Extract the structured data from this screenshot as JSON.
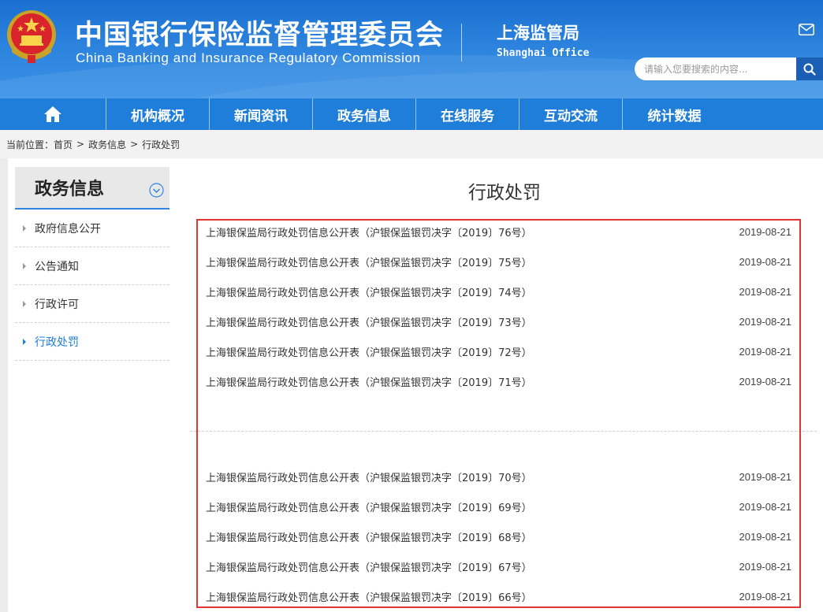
{
  "header": {
    "title_cn": "中国银行保险监督管理委员会",
    "title_en": "China Banking and Insurance Regulatory Commission",
    "office_cn": "上海监管局",
    "office_en": "Shanghai Office",
    "search_placeholder": "请输入您要搜索的内容..."
  },
  "nav": {
    "items": [
      "机构概况",
      "新闻资讯",
      "政务信息",
      "在线服务",
      "互动交流",
      "统计数据"
    ]
  },
  "breadcrumb": {
    "label": "当前位置：",
    "items": [
      "首页",
      "政务信息",
      "行政处罚"
    ],
    "sep": ">"
  },
  "sidebar": {
    "title": "政务信息",
    "items": [
      {
        "label": "政府信息公开",
        "active": false
      },
      {
        "label": "公告通知",
        "active": false
      },
      {
        "label": "行政许可",
        "active": false
      },
      {
        "label": "行政处罚",
        "active": true
      }
    ]
  },
  "main": {
    "title": "行政处罚",
    "list_a": [
      {
        "title": "上海银保监局行政处罚信息公开表（沪银保监银罚决字〔2019〕76号）",
        "date": "2019-08-21"
      },
      {
        "title": "上海银保监局行政处罚信息公开表（沪银保监银罚决字〔2019〕75号）",
        "date": "2019-08-21"
      },
      {
        "title": "上海银保监局行政处罚信息公开表（沪银保监银罚决字〔2019〕74号）",
        "date": "2019-08-21"
      },
      {
        "title": "上海银保监局行政处罚信息公开表（沪银保监银罚决字〔2019〕73号）",
        "date": "2019-08-21"
      },
      {
        "title": "上海银保监局行政处罚信息公开表（沪银保监银罚决字〔2019〕72号）",
        "date": "2019-08-21"
      },
      {
        "title": "上海银保监局行政处罚信息公开表（沪银保监银罚决字〔2019〕71号）",
        "date": "2019-08-21"
      }
    ],
    "list_b": [
      {
        "title": "上海银保监局行政处罚信息公开表（沪银保监银罚决字〔2019〕70号）",
        "date": "2019-08-21"
      },
      {
        "title": "上海银保监局行政处罚信息公开表（沪银保监银罚决字〔2019〕69号）",
        "date": "2019-08-21"
      },
      {
        "title": "上海银保监局行政处罚信息公开表（沪银保监银罚决字〔2019〕68号）",
        "date": "2019-08-21"
      },
      {
        "title": "上海银保监局行政处罚信息公开表（沪银保监银罚决字〔2019〕67号）",
        "date": "2019-08-21"
      },
      {
        "title": "上海银保监局行政处罚信息公开表（沪银保监银罚决字〔2019〕66号）",
        "date": "2019-08-21"
      }
    ]
  },
  "colors": {
    "header_blue": "#2f86df",
    "nav_blue": "#1f7ed9",
    "highlight_red": "#e03535"
  }
}
